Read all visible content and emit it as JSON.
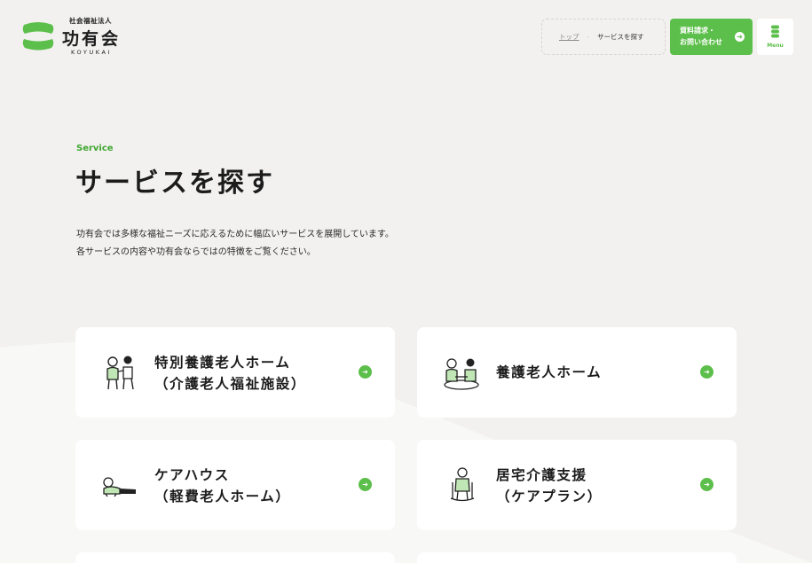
{
  "header": {
    "logo": {
      "org_type": "社会福祉法人",
      "name": "功有会",
      "romanized": "KOYUKAI"
    },
    "breadcrumb": {
      "home": "トップ",
      "separator": "-",
      "current": "サービスを探す"
    },
    "contact_button": {
      "line1": "資料請求・",
      "line2": "お問い合わせ",
      "icon": "arrow-right-circle-icon"
    },
    "menu_button": {
      "label": "Menu",
      "icon": "menu-icon"
    }
  },
  "main": {
    "section_label": "Service",
    "title": "サービスを探す",
    "intro": [
      "功有会では多様な福祉ニーズに応えるために幅広いサービスを展開しています。",
      "各サービスの内容や功有会ならではの特徴をご覧ください。"
    ],
    "services": [
      {
        "line1": "特別養護老人ホーム",
        "line2": "（介護老人福祉施設）",
        "icon": "elderly-walking-illustration"
      },
      {
        "line1": "養護老人ホーム",
        "line2": "",
        "icon": "elderly-table-illustration"
      },
      {
        "line1": "ケアハウス",
        "line2": "（軽費老人ホーム）",
        "icon": "elderly-resting-illustration"
      },
      {
        "line1": "居宅介護支援",
        "line2": "（ケアプラン）",
        "icon": "elderly-chair-illustration"
      }
    ]
  },
  "colors": {
    "accent": "#5dbf4b",
    "accent_text": "#3fa72f",
    "background": "#f2f1f0",
    "card": "#ffffff"
  }
}
